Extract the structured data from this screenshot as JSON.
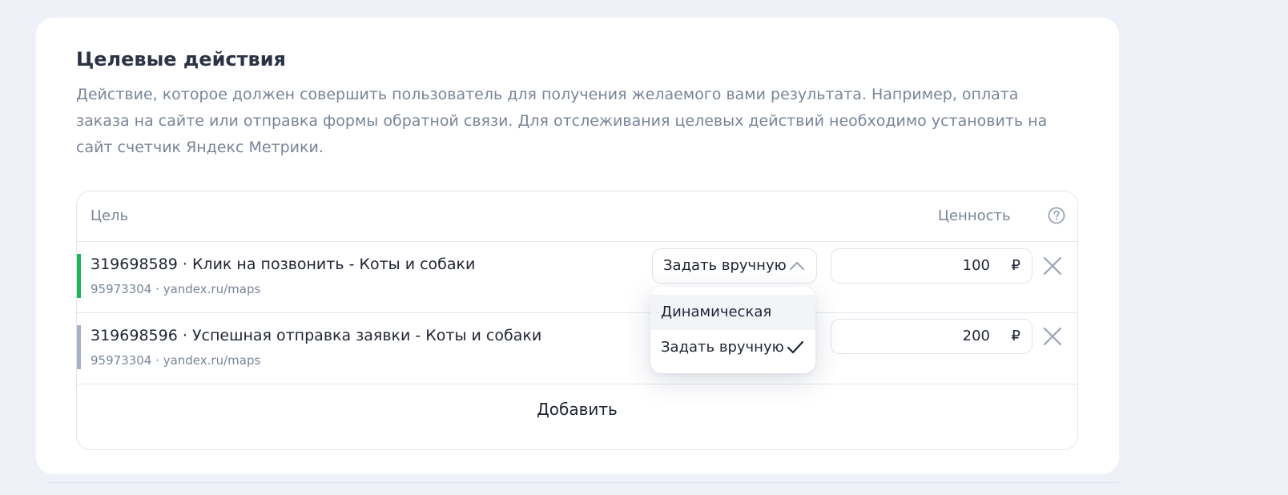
{
  "section": {
    "title": "Целевые действия",
    "description": "Действие, которое должен совершить пользователь для получения желаемого вами результата. Например, оплата заказа на сайте или отправка формы обратной связи. Для отслеживания целевых действий необходимо установить на сайт счетчик Яндекс Метрики."
  },
  "table": {
    "col_goal": "Цель",
    "col_value": "Ценность",
    "help_icon": "question-circle-icon",
    "rows": [
      {
        "goal_id": "319698589",
        "separator": "·",
        "goal_name": "Клик на позвонить - Коты и собаки",
        "counter_id": "95973304",
        "site": "yandex.ru/maps",
        "mode": "Задать вручную",
        "value": "100",
        "currency": "₽",
        "bar_color": "#1fb35c"
      },
      {
        "goal_id": "319698596",
        "separator": "·",
        "goal_name": "Успешная отправка заявки - Коты и собаки",
        "counter_id": "95973304",
        "site": "yandex.ru/maps",
        "value": "200",
        "currency": "₽",
        "bar_color": "#a9b2c4"
      }
    ],
    "add_label": "Добавить"
  },
  "dropdown": {
    "options": [
      {
        "label": "Динамическая",
        "selected": false
      },
      {
        "label": "Задать вручную",
        "selected": true
      }
    ]
  },
  "icons": {
    "chevron": "chevron-up-icon",
    "remove": "close-icon",
    "selected": "check-icon"
  }
}
